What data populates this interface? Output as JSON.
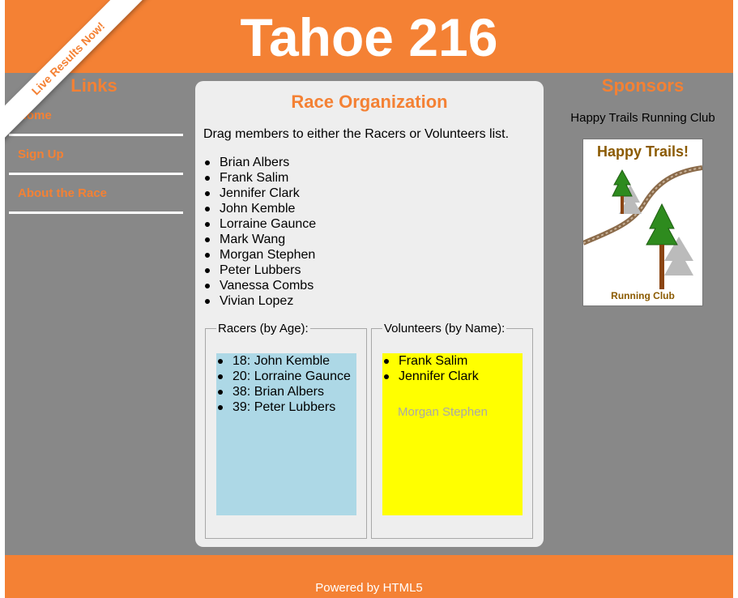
{
  "header": {
    "title": "Tahoe 216",
    "ribbon": "Live Results Now!"
  },
  "links": {
    "heading": "Links",
    "items": [
      {
        "label": "Home"
      },
      {
        "label": "Sign Up"
      },
      {
        "label": "About the Race"
      }
    ]
  },
  "main": {
    "title": "Race Organization",
    "instructions": "Drag members to either the Racers or Volunteers list.",
    "members": [
      "Brian Albers",
      "Frank Salim",
      "Jennifer Clark",
      "John Kemble",
      "Lorraine Gaunce",
      "Mark Wang",
      "Morgan Stephen",
      "Peter Lubbers",
      "Vanessa Combs",
      "Vivian Lopez"
    ],
    "racers": {
      "legend": "Racers (by Age):",
      "items": [
        "18: John Kemble",
        "20: Lorraine Gaunce",
        "38: Brian Albers",
        "39: Peter Lubbers"
      ]
    },
    "volunteers": {
      "legend": "Volunteers (by Name):",
      "items": [
        "Frank Salim",
        "Jennifer Clark"
      ],
      "dragging": "Morgan Stephen"
    }
  },
  "sponsors": {
    "heading": "Sponsors",
    "name": "Happy Trails Running Club",
    "logo_title": "Happy Trails!",
    "logo_subtitle": "Running Club"
  },
  "footer": {
    "text": "Powered by HTML5"
  },
  "colors": {
    "accent": "#f48134",
    "background": "#888888",
    "racers_bg": "#add8e6",
    "volunteers_bg": "#ffff00"
  }
}
